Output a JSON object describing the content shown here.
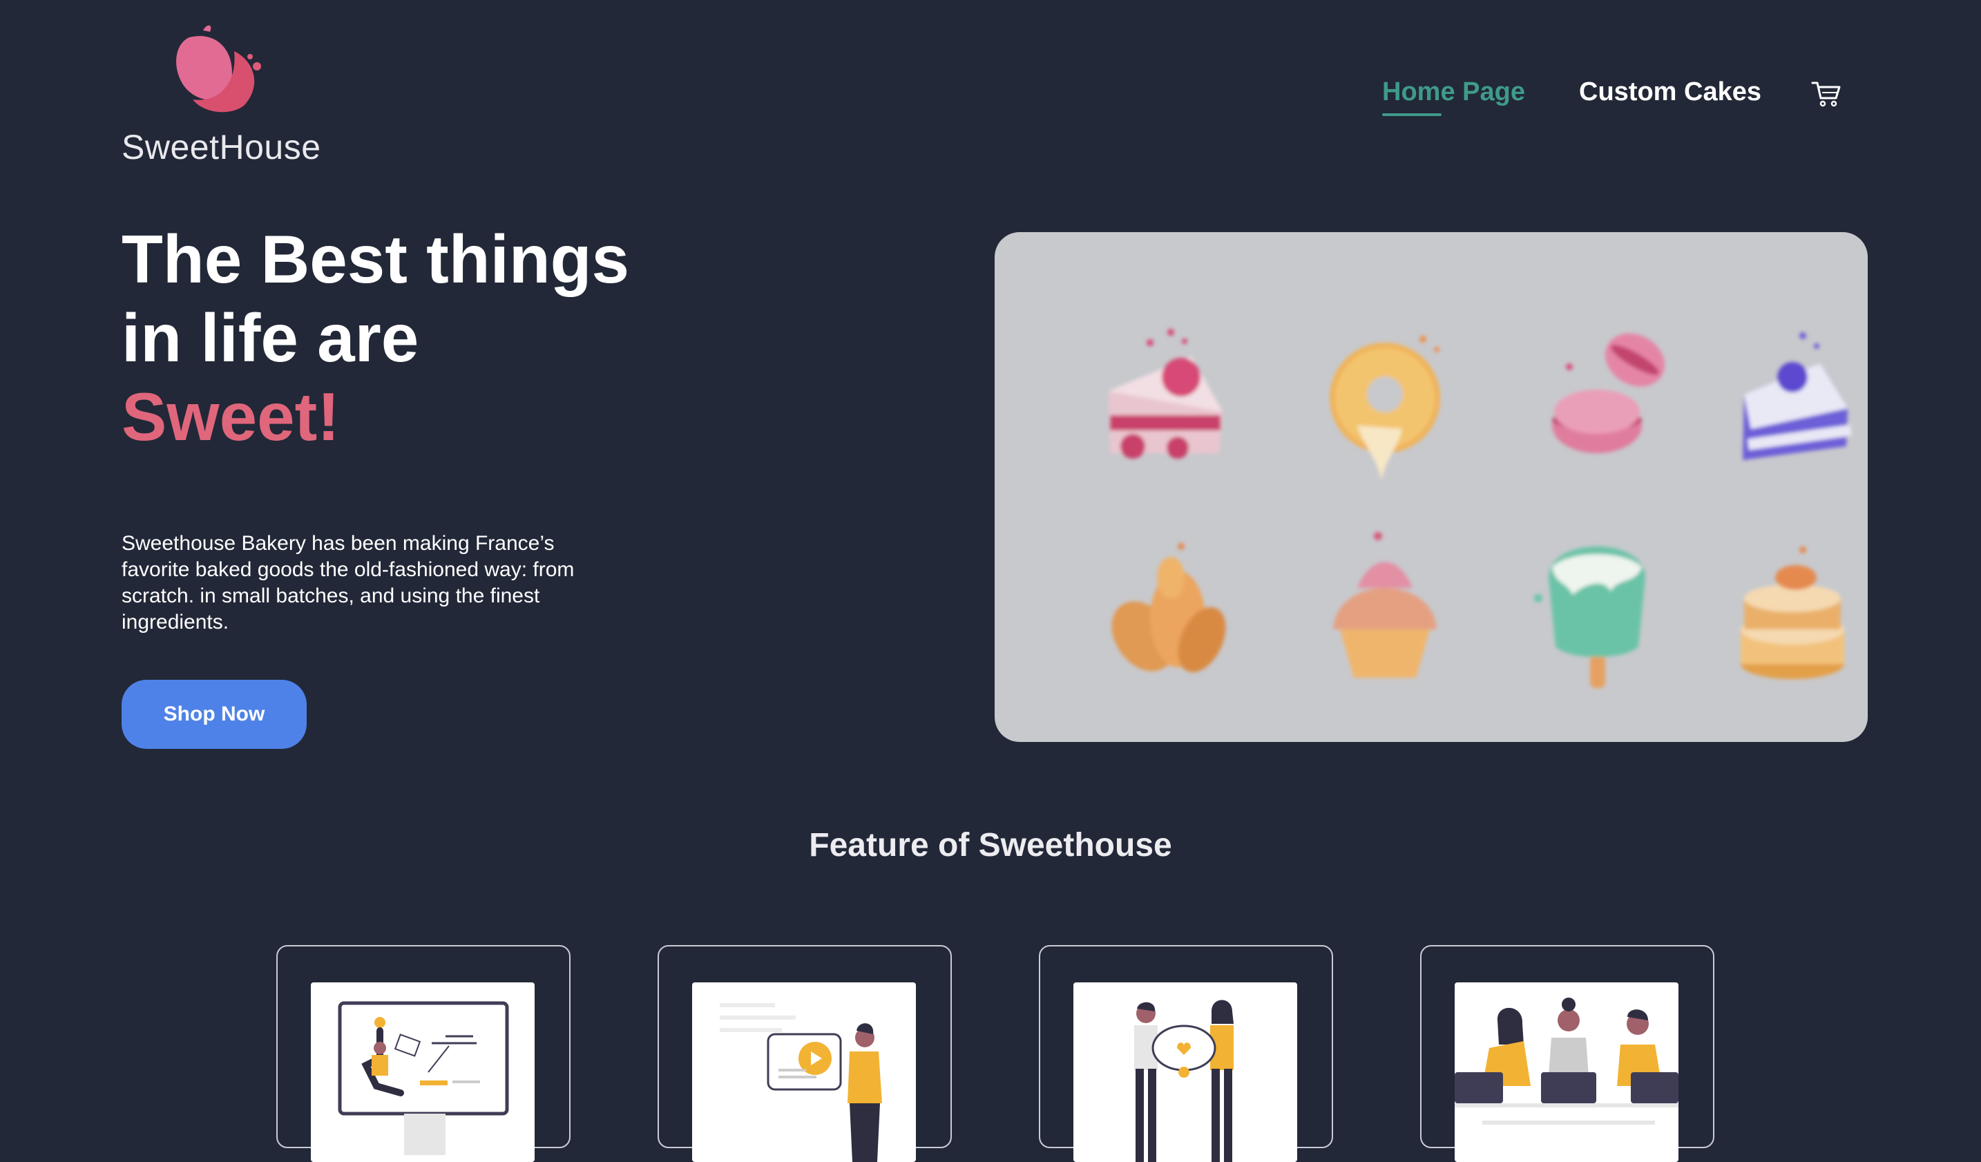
{
  "brand": {
    "name": "SweetHouse",
    "accent": "#e0667c",
    "logo_icon": "petal-logo-icon"
  },
  "nav": {
    "items": [
      {
        "label": "Home Page",
        "active": true,
        "color": "#3f9a8a"
      },
      {
        "label": "Custom Cakes",
        "active": false
      }
    ],
    "cart_icon": "shopping-cart-icon"
  },
  "hero": {
    "title_line1": "The Best things",
    "title_line2": "in life are",
    "title_highlight": "Sweet!",
    "description": "Sweethouse Bakery has been making France’s favorite baked goods the old-fashioned way: from scratch. in small batches, and using the finest ingredients.",
    "cta_label": "Shop Now",
    "cta_color": "#4f82e8"
  },
  "gallery": {
    "icons": [
      "cake-slice-icon",
      "donut-icon",
      "macaron-icon",
      "layer-cake-icon",
      "croissant-icon",
      "cupcake-icon",
      "popsicle-icon",
      "pancake-stack-icon"
    ]
  },
  "features": {
    "title": "Feature of Sweethouse",
    "cards": [
      {
        "illustration": "computer-presentation-illustration"
      },
      {
        "illustration": "video-player-illustration"
      },
      {
        "illustration": "team-collaboration-illustration"
      },
      {
        "illustration": "meeting-laptops-illustration"
      }
    ]
  }
}
